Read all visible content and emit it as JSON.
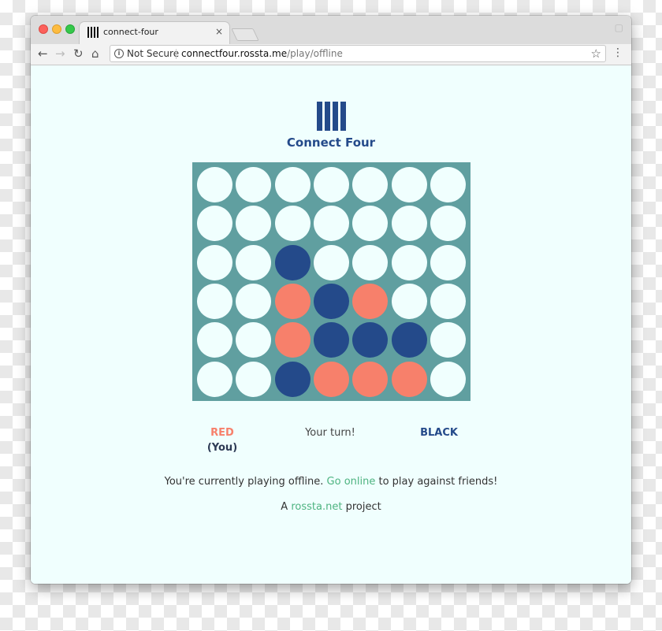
{
  "browser": {
    "tab_title": "connect-four",
    "tab_close": "×",
    "security_label": "Not Secure",
    "url_host": "connectfour.rossta.me",
    "url_path": "/play/offline"
  },
  "app": {
    "title": "Connect Four"
  },
  "board": {
    "columns": 7,
    "rows": 6,
    "grid": [
      [
        "empty",
        "empty",
        "empty",
        "empty",
        "empty",
        "empty",
        "empty"
      ],
      [
        "empty",
        "empty",
        "empty",
        "empty",
        "empty",
        "empty",
        "empty"
      ],
      [
        "empty",
        "empty",
        "black",
        "empty",
        "empty",
        "empty",
        "empty"
      ],
      [
        "empty",
        "empty",
        "red",
        "black",
        "red",
        "empty",
        "empty"
      ],
      [
        "empty",
        "empty",
        "red",
        "black",
        "black",
        "black",
        "empty"
      ],
      [
        "empty",
        "empty",
        "black",
        "red",
        "red",
        "red",
        "empty"
      ]
    ],
    "colors": {
      "board": "#609fa0",
      "empty": "#f0fffe",
      "red": "#f7806b",
      "black": "#244a8a"
    }
  },
  "players": {
    "red_label": "RED",
    "red_you": "(You)",
    "black_label": "BLACK",
    "turn_text": "Your turn!"
  },
  "footer": {
    "offline_prefix": "You're currently playing offline.",
    "offline_link": "Go online",
    "offline_suffix": "to play against friends!",
    "project_prefix": "A",
    "project_link": "rossta.net",
    "project_suffix": "project"
  }
}
